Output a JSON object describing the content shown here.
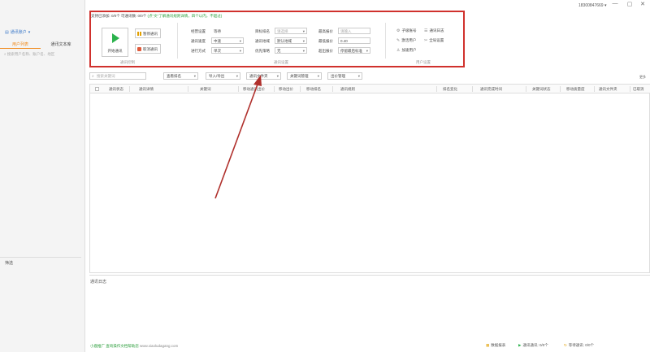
{
  "titlebar": {
    "phone": "18300847669",
    "minimize": "—",
    "maximize": "▢",
    "close": "✕"
  },
  "sidebar": {
    "account_label": "通讯账户",
    "tabs": [
      {
        "label": "用户列表",
        "active": true
      },
      {
        "label": "通讯文本库",
        "active": false
      }
    ],
    "search_placeholder": "搜索用户名称、账户名、地区",
    "filter_label": "筛选"
  },
  "stats": {
    "text": "支持已添加: 0/0个   可通讯数: 0/0个",
    "hint": "(点\"文\"了解通讯规则详情，四个以内，不超过)"
  },
  "panel": {
    "start_label": "开始通讯",
    "pause_label": "暂停通讯",
    "stop_label": "取消通讯",
    "section_control": "通讯控制",
    "section_settings": "通讯设置",
    "section_account": "用户设置",
    "fields": {
      "mode_label": "经营设置",
      "mode_value": "等待",
      "speed_label": "通讯速度",
      "speed_value": "中速",
      "method_label": "进行方式",
      "method_value": "单次",
      "target_label": "目标排名",
      "target_value": "请选择",
      "region_label": "通讯地域",
      "region_value": "默认地域",
      "priority_label": "优先策略",
      "priority_value": "无",
      "max_label": "最高报价",
      "max_placeholder": "请输入",
      "min_label": "最低报价",
      "min_value": "0.40",
      "over_label": "超出报价",
      "over_value": "停留最后标准"
    },
    "account_links": [
      {
        "icon": "⚙",
        "label": "子级账号"
      },
      {
        "icon": "✎",
        "label": "激活用户"
      },
      {
        "icon": "♙",
        "label": "加速用户"
      }
    ],
    "account_links2": [
      {
        "icon": "☰",
        "label": "通讯日志"
      },
      {
        "icon": "✂",
        "label": "全局设置"
      }
    ]
  },
  "toolbar": {
    "search_placeholder": "搜索关键词",
    "buttons": [
      "查看排名",
      "导入/导出",
      "通讯文件夹",
      "关键词管理",
      "出价管理"
    ],
    "right_label": "更多"
  },
  "table": {
    "columns": [
      "通讯状态",
      "通讯详情",
      "关键词",
      "移动通讯出价",
      "移动出价",
      "移动排名",
      "通讯规则",
      "排名变化",
      "通讯完成时间",
      "关键词状态",
      "移动质量度",
      "通讯文件夹",
      "已取消"
    ]
  },
  "log": {
    "title": "通讯日志"
  },
  "footer": {
    "brand": "小鹿推广",
    "link_text": "查询操作文档帮助您",
    "url": "www.xiaoludagang.com",
    "items": [
      "数据报表",
      "通讯通讯: 0/0个",
      "等待通讯: 0/0个"
    ]
  },
  "colors": {
    "accent": "#f08a1c",
    "link": "#3a78c8",
    "start_green": "#2bb24c",
    "highlight_red": "#d0312d"
  }
}
